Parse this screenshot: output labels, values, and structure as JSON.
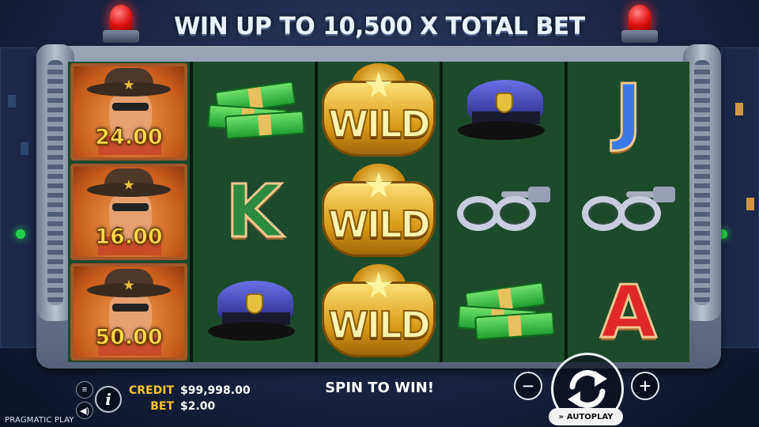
{
  "banner": {
    "headline": "WIN UP TO 10,500 X TOTAL BET"
  },
  "reels": [
    {
      "symbols": [
        {
          "type": "sheriff-multiplier",
          "label": "24.00"
        },
        {
          "type": "sheriff-multiplier",
          "label": "16.00"
        },
        {
          "type": "sheriff-multiplier",
          "label": "50.00"
        }
      ]
    },
    {
      "symbols": [
        {
          "type": "cash"
        },
        {
          "type": "letter",
          "label": "K"
        },
        {
          "type": "police-cap"
        }
      ]
    },
    {
      "symbols": [
        {
          "type": "wild",
          "label": "WILD"
        },
        {
          "type": "wild",
          "label": "WILD"
        },
        {
          "type": "wild",
          "label": "WILD"
        }
      ]
    },
    {
      "symbols": [
        {
          "type": "police-cap"
        },
        {
          "type": "handcuffs"
        },
        {
          "type": "cash"
        }
      ]
    },
    {
      "symbols": [
        {
          "type": "letter",
          "label": "J"
        },
        {
          "type": "handcuffs"
        },
        {
          "type": "letter",
          "label": "A"
        }
      ]
    }
  ],
  "hud": {
    "credit_label": "CREDIT",
    "credit_value": "$99,998.00",
    "bet_label": "BET",
    "bet_value": "$2.00",
    "message": "SPIN TO WIN!",
    "info_label": "i",
    "minus_label": "−",
    "plus_label": "+",
    "autoplay_label": "AUTOPLAY",
    "brand": "PRAGMATIC PLAY"
  },
  "icons": {
    "menu": "menu-icon",
    "sound": "sound-icon",
    "info": "info-icon",
    "spin": "spin-arrows-icon",
    "siren": "siren-icon"
  },
  "colors": {
    "label_gold": "#f6c431",
    "reel_green": "#1d4a2b",
    "multiplier_gold": "#ffd84a"
  }
}
